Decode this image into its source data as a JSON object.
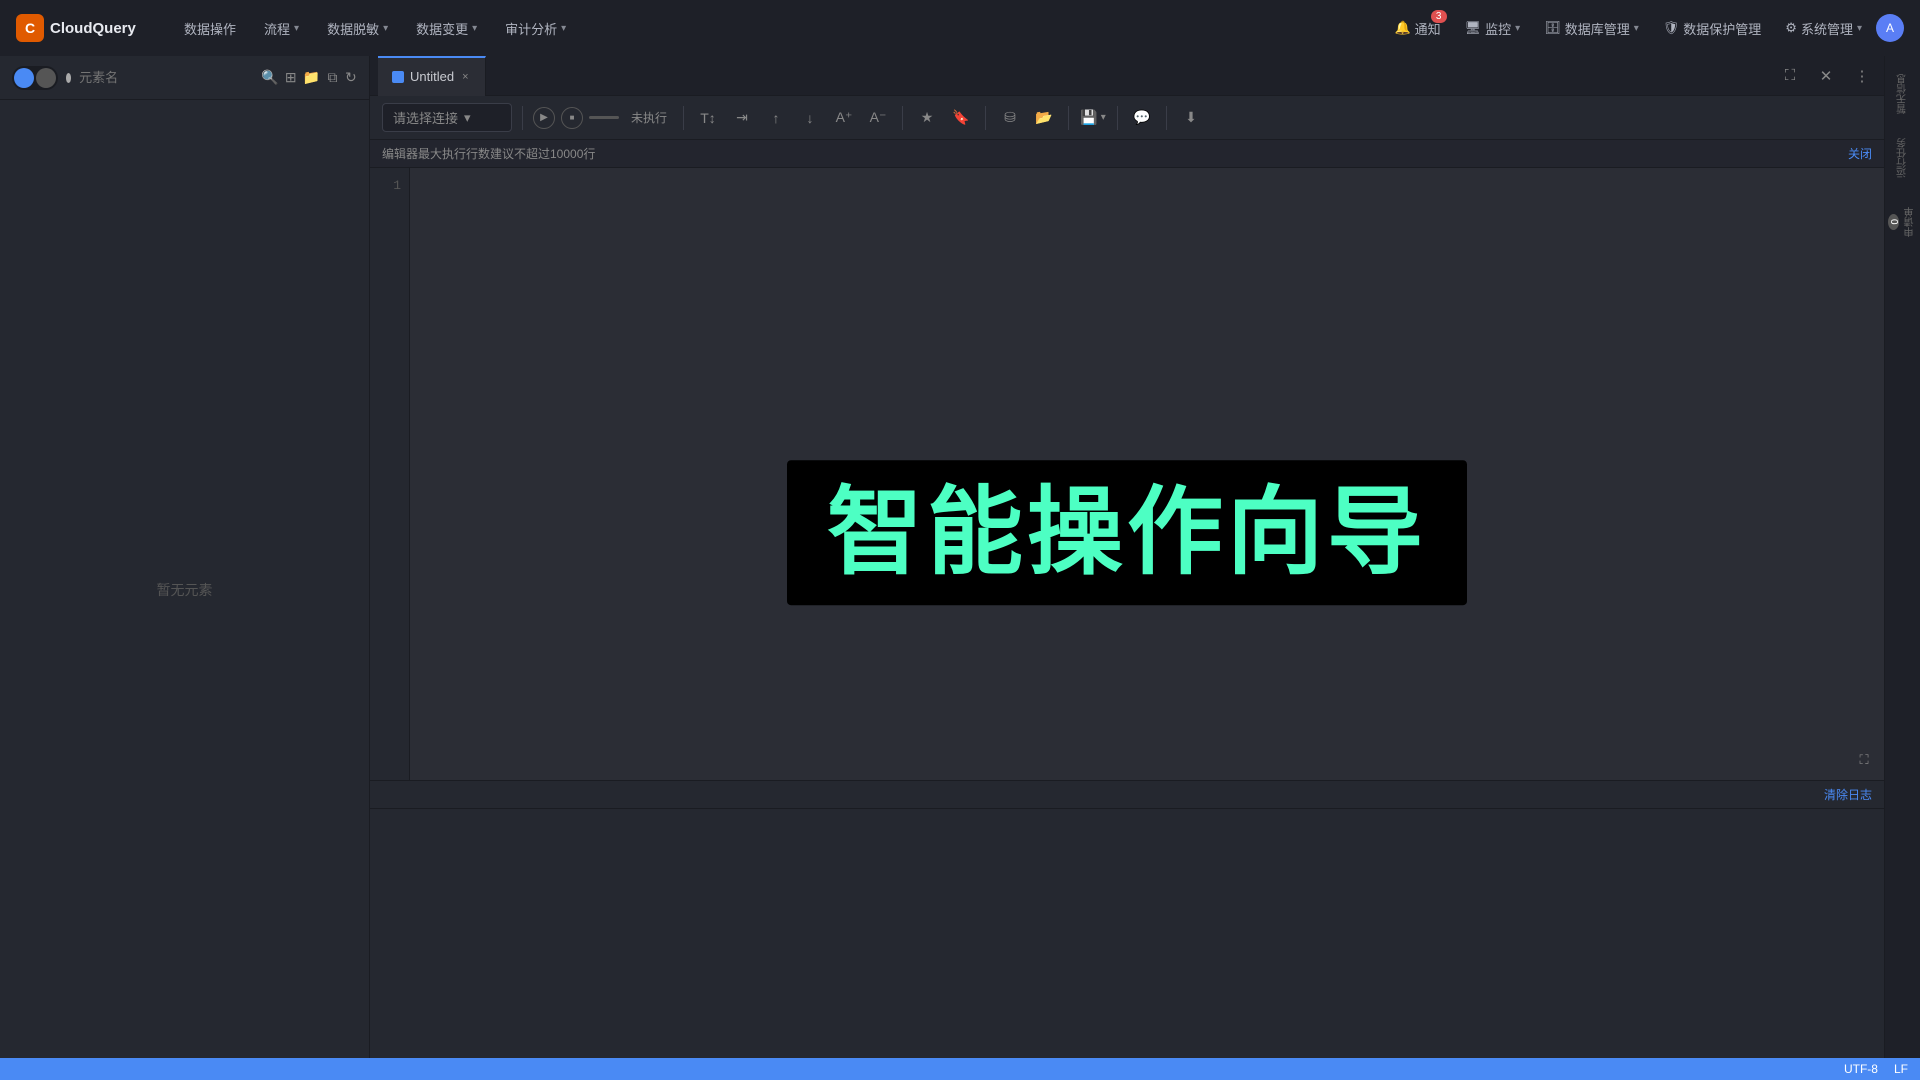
{
  "app": {
    "name": "CloudQuery",
    "logo_letter": "C"
  },
  "nav": {
    "items": [
      {
        "label": "数据操作",
        "has_arrow": false
      },
      {
        "label": "流程",
        "has_arrow": true
      },
      {
        "label": "数据脱敏",
        "has_arrow": true
      },
      {
        "label": "数据变更",
        "has_arrow": true
      },
      {
        "label": "审计分析",
        "has_arrow": true
      }
    ],
    "right_items": [
      {
        "label": "通知",
        "icon": "bell-icon",
        "badge": "3"
      },
      {
        "label": "监控",
        "icon": "monitor-icon",
        "has_arrow": true
      },
      {
        "label": "数据库管理",
        "icon": "db-icon",
        "has_arrow": true
      },
      {
        "label": "数据保护管理",
        "icon": "shield-icon"
      },
      {
        "label": "系统管理",
        "icon": "gear-icon",
        "has_arrow": true
      }
    ]
  },
  "sidebar": {
    "search_placeholder": "元素名",
    "empty_text": "暂无元素"
  },
  "tab": {
    "title": "Untitled",
    "close_label": "×"
  },
  "toolbar": {
    "connection_placeholder": "请选择连接",
    "run_status": "未执行",
    "dropdown_arrow": "▾"
  },
  "notice": {
    "text": "编辑器最大执行行数建议不超过10000行",
    "close_label": "关闭"
  },
  "editor": {
    "line_numbers": [
      "1"
    ]
  },
  "log": {
    "clear_label": "清除日志"
  },
  "banner": {
    "text": "智能操作向导"
  },
  "right_sidebar": {
    "items": [
      {
        "label": "暂无信息",
        "badge": null
      },
      {
        "label": "运行任务",
        "badge": null
      },
      {
        "label": "申请单",
        "badge": "0"
      }
    ]
  },
  "status_bar": {
    "encoding": "UTF-8",
    "line_ending": "LF"
  }
}
